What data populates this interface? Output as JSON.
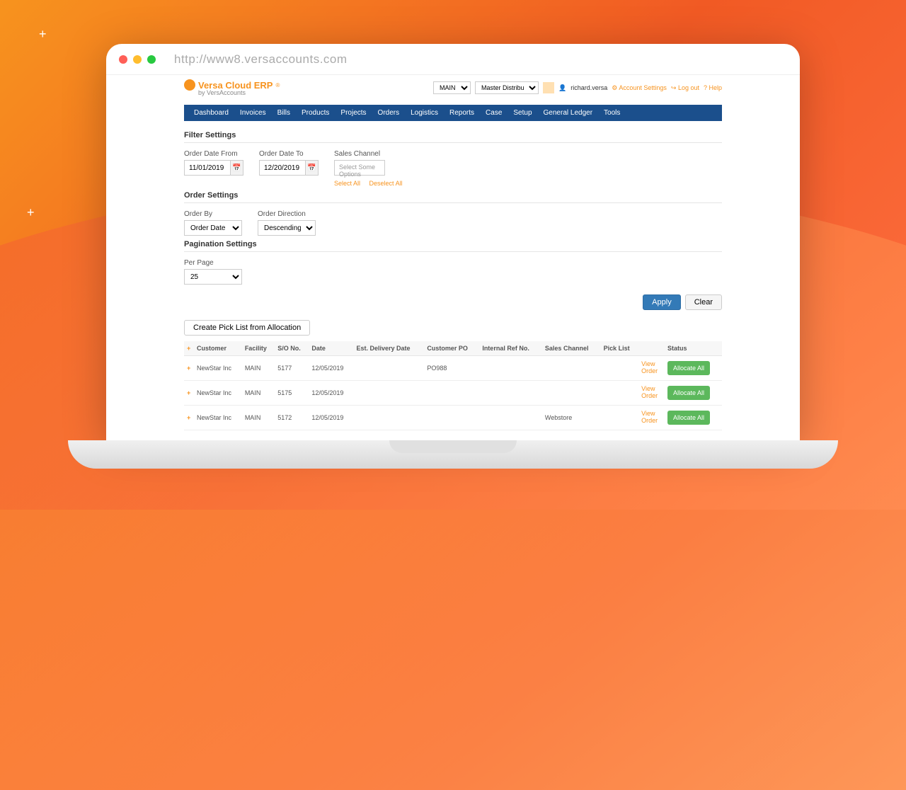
{
  "browser": {
    "url": "http://www8.versaccounts.com"
  },
  "header": {
    "logo_text": "Versa Cloud ERP",
    "logo_sub": "by VersAccounts",
    "location": "MAIN",
    "company": "Master Distribution",
    "user": "richard.versa",
    "links": {
      "settings": "Account Settings",
      "logout": "Log out",
      "help": "Help"
    }
  },
  "nav": [
    "Dashboard",
    "Invoices",
    "Bills",
    "Products",
    "Projects",
    "Orders",
    "Logistics",
    "Reports",
    "Case",
    "Setup",
    "General Ledger",
    "Tools"
  ],
  "filter": {
    "title": "Filter Settings",
    "from_label": "Order Date From",
    "from_value": "11/01/2019",
    "to_label": "Order Date To",
    "to_value": "12/20/2019",
    "channel_label": "Sales Channel",
    "channel_placeholder": "Select Some Options",
    "select_all": "Select All",
    "deselect_all": "Deselect All"
  },
  "order": {
    "title": "Order Settings",
    "by_label": "Order By",
    "by_value": "Order Date",
    "dir_label": "Order Direction",
    "dir_value": "Descending"
  },
  "pagination": {
    "title": "Pagination Settings",
    "per_page_label": "Per Page",
    "per_page_value": "25"
  },
  "buttons": {
    "apply": "Apply",
    "clear": "Clear",
    "create_pick": "Create Pick List from Allocation"
  },
  "table": {
    "headers": [
      "",
      "Customer",
      "Facility",
      "S/O No.",
      "Date",
      "Est. Delivery Date",
      "Customer PO",
      "Internal Ref No.",
      "Sales Channel",
      "Pick List",
      "",
      "Status"
    ],
    "view_label": "View Order",
    "allocate_label": "Allocate All",
    "rows": [
      {
        "customer": "NewStar Inc",
        "facility": "MAIN",
        "so": "5177",
        "date": "12/05/2019",
        "po": "PO988",
        "channel": ""
      },
      {
        "customer": "NewStar Inc",
        "facility": "MAIN",
        "so": "5175",
        "date": "12/05/2019",
        "po": "",
        "channel": ""
      },
      {
        "customer": "NewStar Inc",
        "facility": "MAIN",
        "so": "5172",
        "date": "12/05/2019",
        "po": "",
        "channel": "Webstore"
      }
    ]
  }
}
